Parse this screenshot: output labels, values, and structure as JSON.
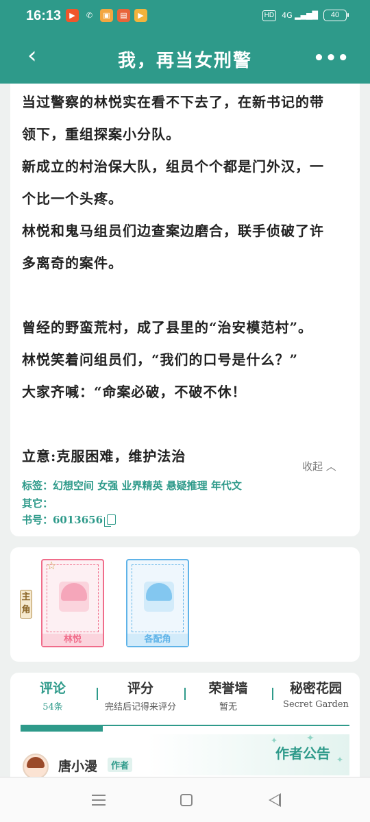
{
  "status_bar": {
    "time": "16:13",
    "network": "4G",
    "hd": "HD",
    "battery": "40",
    "apps": [
      {
        "icon": "video-app-icon",
        "color": "#f0562b",
        "glyph": "▶"
      },
      {
        "icon": "wechat-icon",
        "color": "#2e9a8a",
        "glyph": "✆"
      },
      {
        "icon": "live-app-icon",
        "color": "#f3a640",
        "glyph": "▣"
      },
      {
        "icon": "reader-app-icon",
        "color": "#e8643a",
        "glyph": "▤"
      },
      {
        "icon": "media-app-icon",
        "color": "#f2b33c",
        "glyph": "▶"
      }
    ]
  },
  "header": {
    "title": "我，再当女刑警",
    "back_glyph": "‹",
    "more_glyph": "•••"
  },
  "synopsis": {
    "lines": [
      "当过警察的林悦实在看不下去了，在新书记的带",
      "领下，重组探案小分队。",
      "新成立的村治保大队，组员个个都是门外汉，一",
      "个比一个头疼。",
      "林悦和鬼马组员们边查案边磨合，联手侦破了许",
      "多离奇的案件。",
      "",
      "曾经的野蛮荒村，成了县里的“治安模范村”。",
      "林悦笑着问组员们，“我们的口号是什么？”",
      "大家齐喊：“命案必破，不破不休！",
      "",
      "立意:克服困难，维护法治"
    ],
    "collapse_label": "收起",
    "collapse_glyph": "︿"
  },
  "meta": {
    "tags": "标签：幻想空间 女强 业界精英 悬疑推理 年代文",
    "other": "其它：",
    "book_id": "书号：6013656"
  },
  "roles": {
    "tag": "主角",
    "cards": [
      {
        "name": "林悦",
        "color": "#f06c8a",
        "bg": "#fdf0f3",
        "face": "#fbd4dd",
        "hair": "#f5a6ba"
      },
      {
        "name": "各配角",
        "color": "#5fb3e8",
        "bg": "#eff7fd",
        "face": "#d2ebfa",
        "hair": "#83c7f0"
      }
    ]
  },
  "tabs": [
    {
      "label": "评论",
      "sub": "54条",
      "active": true
    },
    {
      "label": "评分",
      "sub": "完结后记得来评分",
      "active": false
    },
    {
      "label": "荣誉墙",
      "sub": "暂无",
      "active": false
    },
    {
      "label": "秘密花园",
      "sub": "Secret Garden",
      "active": false
    }
  ],
  "comment": {
    "notice_label": "作者公告",
    "author_name": "唐小漫",
    "author_badge": "作者"
  },
  "colors": {
    "accent": "#2e9a8a",
    "background": "#eef1f0"
  }
}
